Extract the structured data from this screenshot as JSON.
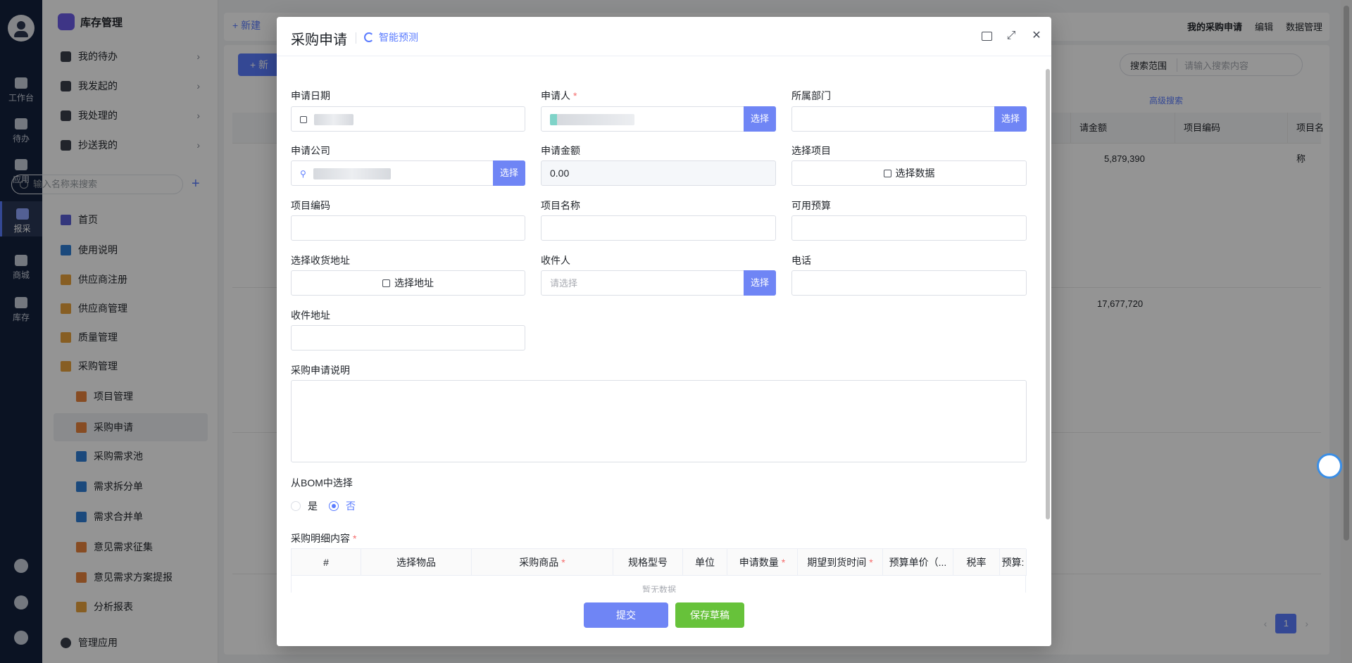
{
  "rail": {
    "items": [
      {
        "label": "工作台"
      },
      {
        "label": "待办"
      },
      {
        "label": "应用"
      },
      {
        "label": "报采"
      },
      {
        "label": "商城"
      },
      {
        "label": "库存"
      }
    ]
  },
  "sidebar": {
    "title": "库存管理",
    "quick": [
      {
        "label": "我的待办"
      },
      {
        "label": "我发起的"
      },
      {
        "label": "我处理的"
      },
      {
        "label": "抄送我的"
      }
    ],
    "search_placeholder": "输入名称来搜索",
    "nav": [
      {
        "label": "首页"
      },
      {
        "label": "使用说明"
      },
      {
        "label": "供应商注册"
      },
      {
        "label": "供应商管理"
      },
      {
        "label": "质量管理"
      },
      {
        "label": "采购管理"
      },
      {
        "label": "项目管理"
      },
      {
        "label": "采购申请"
      },
      {
        "label": "采购需求池"
      },
      {
        "label": "需求拆分单"
      },
      {
        "label": "需求合并单"
      },
      {
        "label": "意见需求征集"
      },
      {
        "label": "意见需求方案提报"
      },
      {
        "label": "分析报表"
      }
    ],
    "footer": "管理应用"
  },
  "main": {
    "new_label": "+ 新建",
    "top_right": {
      "title": "我的采购申请",
      "edit": "编辑",
      "data": "数据管理"
    },
    "add_label": "+ 新",
    "search_range": "搜索范围",
    "search_placeholder": "请输入搜索内容",
    "advanced": "高级搜索",
    "columns": [
      "请金额",
      "项目编码",
      "项目名称"
    ],
    "rows": [
      {
        "amount": "5,879,390"
      },
      {
        "amount": "17,677,720"
      },
      {
        "amount": ""
      }
    ],
    "page": "1"
  },
  "modal": {
    "title": "采购申请",
    "ai_label": "智能预测",
    "fields": {
      "apply_date": {
        "label": "申请日期"
      },
      "applicant": {
        "label": "申请人",
        "button": "选择"
      },
      "department": {
        "label": "所属部门",
        "button": "选择"
      },
      "company": {
        "label": "申请公司",
        "button": "选择"
      },
      "amount": {
        "label": "申请金额",
        "value": "0.00"
      },
      "project": {
        "label": "选择项目",
        "button": "选择数据"
      },
      "project_code": {
        "label": "项目编码"
      },
      "project_name": {
        "label": "项目名称"
      },
      "budget": {
        "label": "可用预算"
      },
      "address_select": {
        "label": "选择收货地址",
        "button": "选择地址"
      },
      "receiver": {
        "label": "收件人",
        "placeholder": "请选择",
        "button": "选择"
      },
      "phone": {
        "label": "电话"
      },
      "address": {
        "label": "收件地址"
      },
      "description": {
        "label": "采购申请说明"
      },
      "bom": {
        "label": "从BOM中选择",
        "yes": "是",
        "no": "否",
        "selected": "否"
      },
      "details": {
        "label": "采购明细内容"
      }
    },
    "detail_columns": [
      {
        "label": "#",
        "required": false
      },
      {
        "label": "选择物品",
        "required": false
      },
      {
        "label": "采购商品",
        "required": true
      },
      {
        "label": "规格型号",
        "required": false
      },
      {
        "label": "单位",
        "required": false
      },
      {
        "label": "申请数量",
        "required": true
      },
      {
        "label": "期望到货时间",
        "required": true
      },
      {
        "label": "预算单价（...",
        "required": false
      },
      {
        "label": "税率",
        "required": false
      },
      {
        "label": "预算:",
        "required": false
      }
    ],
    "empty_text": "暂无数据",
    "submit": "提交",
    "save_draft": "保存草稿"
  }
}
